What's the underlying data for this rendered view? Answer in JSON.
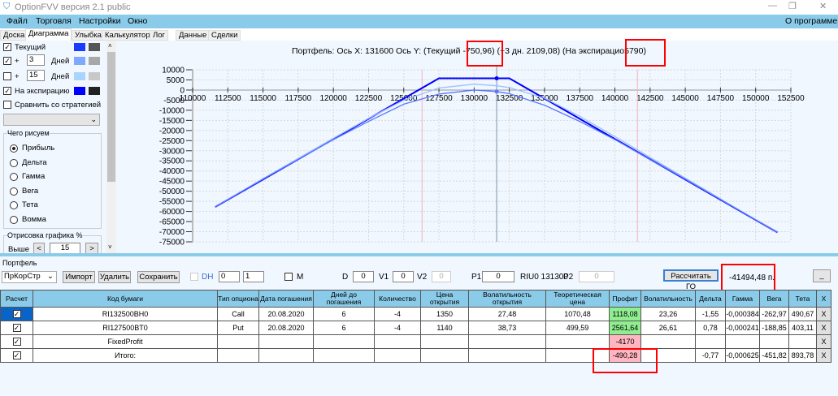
{
  "window": {
    "title": "OptionFVV версия 2.1 public"
  },
  "menu": {
    "items": [
      "Файл",
      "Торговля",
      "Настройки",
      "Окно"
    ],
    "about": "О программе"
  },
  "tabs": [
    "Доска",
    "Диаграмма",
    "Улыбка",
    "Калькулятор",
    "Лог",
    "Данные",
    "Сделки"
  ],
  "left": {
    "current": {
      "label": "Текущий",
      "checked": true,
      "colors": [
        "#1a3cff",
        "#555555"
      ]
    },
    "plus1": {
      "prefix": "+",
      "days": "3",
      "unit": "Дней",
      "checked": true,
      "colors": [
        "#7fa8ff",
        "#a8a8a8"
      ]
    },
    "plus2": {
      "prefix": "+",
      "days": "15",
      "unit": "Дней",
      "checked": false,
      "colors": [
        "#aad4ff",
        "#c8c8c8"
      ]
    },
    "expiry": {
      "label": "На экспирацию",
      "checked": true,
      "colors": [
        "#0000ff",
        "#222222"
      ]
    },
    "compare": {
      "label": "Сравнить со стратегией",
      "checked": false
    },
    "what_title": "Чего рисуем",
    "radios": [
      "Прибыль",
      "Дельта",
      "Гамма",
      "Вега",
      "Тета",
      "Вомма"
    ],
    "selected_radio": "Прибыль",
    "draw_title": "Отрисовка графика %",
    "above_label": "Выше",
    "above_value": "15",
    "prev": "<",
    "next": ">"
  },
  "chart_header": {
    "prefix": "Портфель: Ось X: 131600 Ось Y:  (Текущий",
    "current": "-750,96)",
    "plus3": "(+3 дн. 2109,08)",
    "exp_prefix": "(На экспирацио",
    "exp_value": "5790)"
  },
  "chart_data": {
    "type": "line",
    "xlim": [
      110000,
      152500
    ],
    "ylim": [
      -75000,
      10000
    ],
    "xticks": [
      110000,
      112500,
      115000,
      117500,
      120000,
      122500,
      125000,
      127500,
      130000,
      132500,
      135000,
      137500,
      140000,
      142500,
      145000,
      147500,
      150000,
      152500
    ],
    "yticks": [
      10000,
      5000,
      0,
      -5000,
      -10000,
      -15000,
      -20000,
      -25000,
      -30000,
      -35000,
      -40000,
      -45000,
      -50000,
      -55000,
      -60000,
      -65000,
      -70000,
      -75000
    ],
    "grid": true,
    "cursor_x": 131600,
    "bounds_x": [
      126300,
      141600
    ],
    "series": [
      {
        "color": "#0000ff",
        "x": [
          111600,
          127500,
          132500,
          151550
        ],
        "y": [
          -57800,
          5790,
          5790,
          -70400
        ]
      },
      {
        "color": "#9ec0ff",
        "x": [
          111600,
          115000,
          120000,
          122500,
          125000,
          127500,
          130000,
          131600,
          132500,
          135000,
          137500,
          140000,
          145000,
          151550
        ],
        "y": [
          -57800,
          -43800,
          -23800,
          -14000,
          -5000,
          1000,
          2900,
          2109,
          1200,
          -4000,
          -13000,
          -23000,
          -43500,
          -70400
        ]
      },
      {
        "color": "#5a78ff",
        "x": [
          111600,
          115000,
          120000,
          122500,
          125000,
          127500,
          130000,
          131600,
          132500,
          135000,
          137500,
          140000,
          145000,
          151550
        ],
        "y": [
          -57800,
          -44000,
          -24500,
          -15500,
          -7000,
          -2000,
          0,
          -751,
          -1800,
          -7500,
          -15500,
          -24500,
          -44000,
          -70400
        ]
      }
    ]
  },
  "portfolio": {
    "title": "Портфель",
    "strategy": "ПрКорСтр",
    "import": "Импорт",
    "delete": "Удалить",
    "save": "Сохранить",
    "dh": "DH",
    "spin1": "0",
    "spin2": "1",
    "m": "M",
    "d_label": "D",
    "d": "0",
    "v1_label": "V1",
    "v1": "0",
    "v2_label": "V2",
    "v2": "0",
    "p1_label": "P1",
    "p1": "0",
    "riu": "RIU0 131300",
    "p2_label": "P2",
    "p2": "0",
    "calc_go": "Рассчитать ГО",
    "go_value": "-41494,48 п.",
    "minimize": "_"
  },
  "table": {
    "headers": [
      "Расчет",
      "Код бумаги",
      "Тип опциона",
      "Дата погашения",
      "Дней до погашения",
      "Количество",
      "Цена открытия",
      "Волатильность открытия",
      "Теоретическая цена",
      "Профит",
      "Волатильность",
      "Дельта",
      "Гамма",
      "Вега",
      "Тета",
      "X"
    ],
    "rows": [
      [
        "✓",
        "RI132500BH0",
        "Call",
        "20.08.2020",
        "6",
        "-4",
        "1350",
        "27,48",
        "1070,48",
        "1118,08",
        "23,26",
        "-1,55",
        "-0,000384",
        "-262,97",
        "490,67",
        "X"
      ],
      [
        "✓",
        "RI127500BT0",
        "Put",
        "20.08.2020",
        "6",
        "-4",
        "1140",
        "38,73",
        "499,59",
        "2561,64",
        "26,61",
        "0,78",
        "-0,000241",
        "-188,85",
        "403,11",
        "X"
      ],
      [
        "✓",
        "FixedProfit",
        "",
        "",
        "",
        "",
        "",
        "",
        "",
        "-4170",
        "",
        "",
        "",
        "",
        "",
        "X"
      ],
      [
        "✓",
        "Итого:",
        "",
        "",
        "",
        "",
        "",
        "",
        "",
        "-490,28",
        "",
        "-0,77",
        "-0,000625",
        "-451,82",
        "893,78",
        "X"
      ]
    ],
    "profit_colors": [
      "#90ee90",
      "#90ee90",
      "#ffb6c1",
      "#ffb6c1"
    ]
  }
}
